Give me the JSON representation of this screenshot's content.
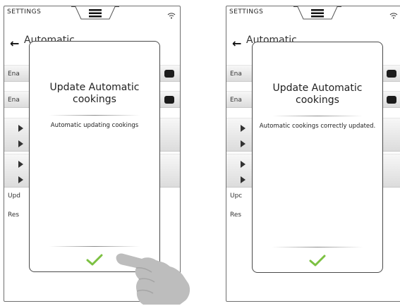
{
  "colors": {
    "confirm_check": "#7cc142",
    "toggle": "#1c1c1c",
    "hand": "#bdbdbd"
  },
  "screens": [
    {
      "status_title": "SETTINGS",
      "list_title": "Automatic",
      "rows": [
        "Ena",
        "Ena",
        "Upd",
        "Res"
      ],
      "dialog": {
        "title": "Update Automatic cookings",
        "message": "Automatic updating cookings",
        "confirm_icon": "checkmark-icon"
      }
    },
    {
      "status_title": "SETTINGS",
      "list_title": "Automatic",
      "rows": [
        "Ena",
        "Ena",
        "Upc",
        "Res"
      ],
      "dialog": {
        "title": "Update Automatic cookings",
        "message": "Automatic cookings correctly updated.",
        "confirm_icon": "checkmark-icon"
      }
    }
  ]
}
